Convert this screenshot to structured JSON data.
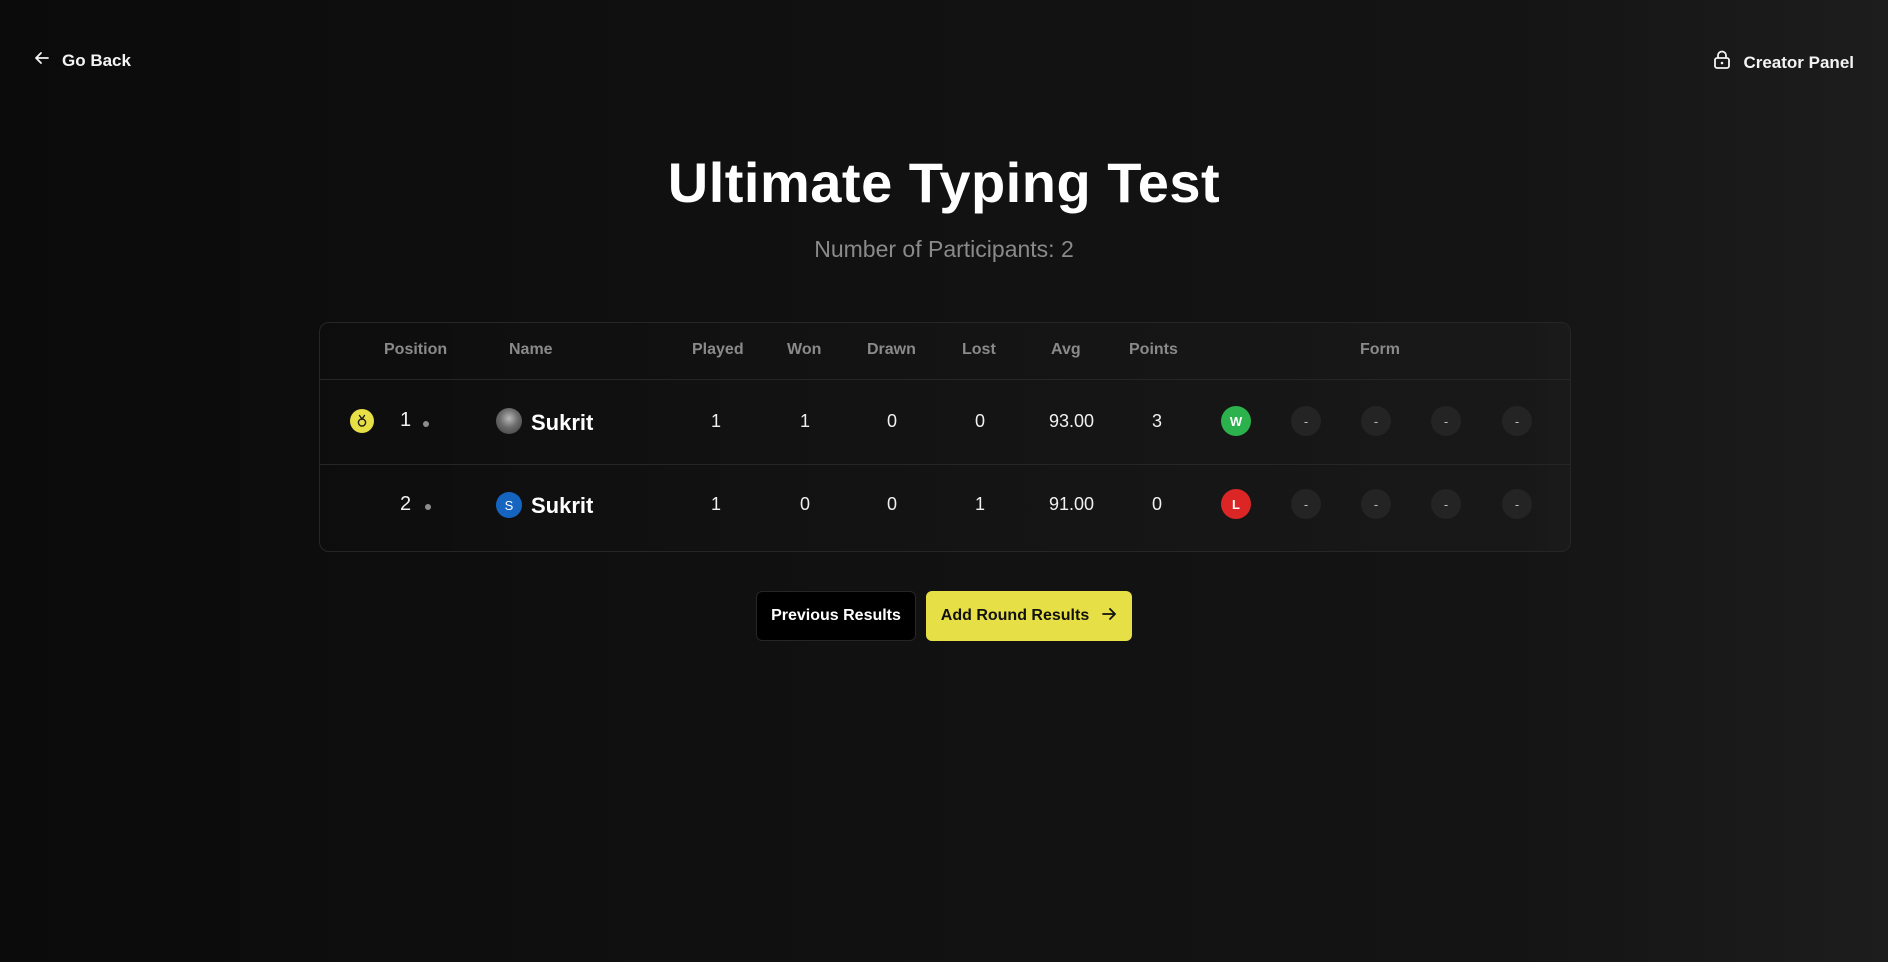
{
  "nav": {
    "go_back_label": "Go Back",
    "creator_panel_label": "Creator Panel"
  },
  "header": {
    "title": "Ultimate Typing Test",
    "participants_text": "Number of Participants: 2"
  },
  "table": {
    "columns": {
      "position": "Position",
      "name": "Name",
      "played": "Played",
      "won": "Won",
      "drawn": "Drawn",
      "lost": "Lost",
      "avg": "Avg",
      "points": "Points",
      "form": "Form"
    },
    "rows": [
      {
        "position": "1",
        "name": "Sukrit",
        "avatar": "photo",
        "played": "1",
        "won": "1",
        "drawn": "0",
        "lost": "0",
        "avg": "93.00",
        "points": "3",
        "form": [
          "W",
          "-",
          "-",
          "-",
          "-"
        ],
        "has_medal": true
      },
      {
        "position": "2",
        "name": "Sukrit",
        "avatar": "initial",
        "avatar_initial": "S",
        "played": "1",
        "won": "0",
        "drawn": "0",
        "lost": "1",
        "avg": "91.00",
        "points": "0",
        "form": [
          "L",
          "-",
          "-",
          "-",
          "-"
        ],
        "has_medal": false
      }
    ]
  },
  "actions": {
    "previous_label": "Previous Results",
    "add_label": "Add Round Results"
  },
  "icons": {
    "back": "arrow-left-icon",
    "creator": "lock-icon",
    "medal": "medal-icon",
    "add": "arrow-right-icon"
  },
  "colors": {
    "accent_yellow": "#e6df45",
    "win_green": "#2bb24c",
    "loss_red": "#dc2626",
    "avatar_blue": "#1565c0"
  }
}
